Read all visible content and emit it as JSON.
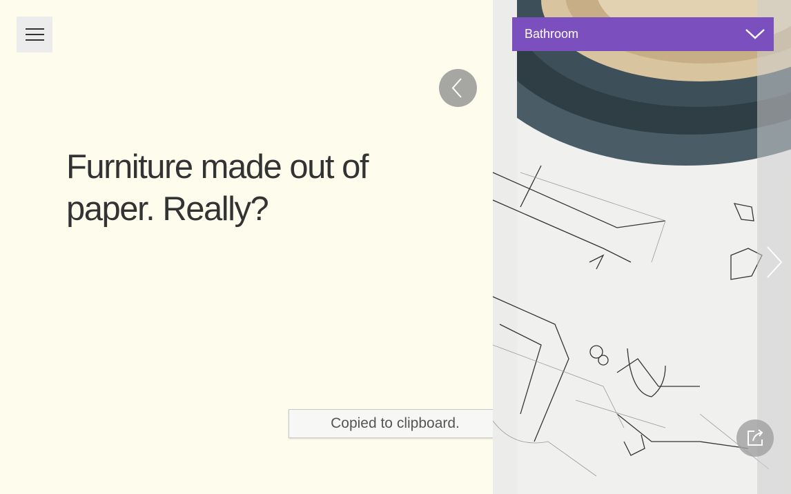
{
  "headline": "Furniture made out of paper. Really?",
  "category": {
    "selected": "Bathroom"
  },
  "toast": {
    "message": "Copied to clipboard."
  },
  "colors": {
    "background": "#fefcec",
    "accent": "#7b4fbd",
    "text": "#333333"
  },
  "icons": {
    "menu": "hamburger-icon",
    "prev": "chevron-left-icon",
    "next": "chevron-right-icon",
    "dropdown": "chevron-down-icon",
    "share": "share-icon"
  }
}
